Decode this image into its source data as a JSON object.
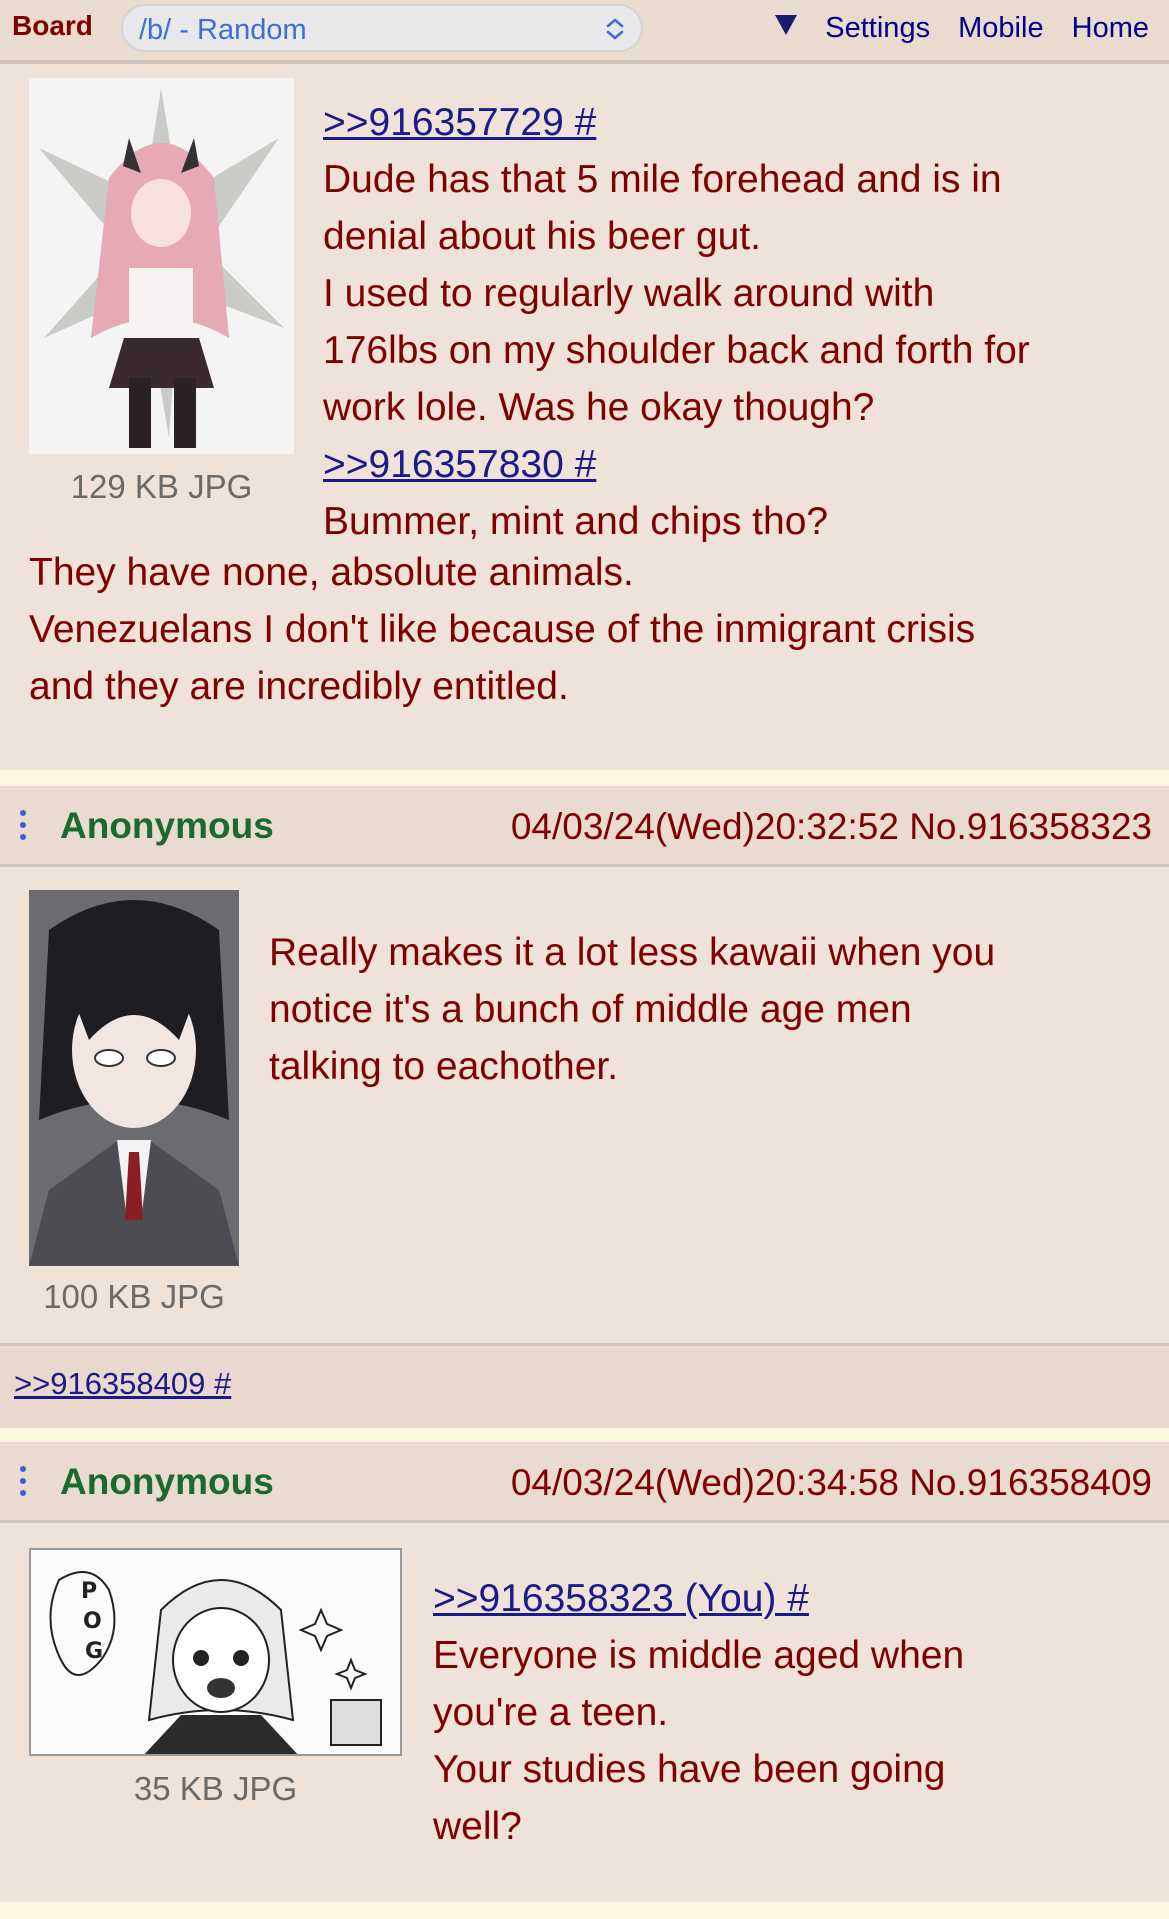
{
  "topbar": {
    "board_label": "Board",
    "board_select_value": "/b/ - Random",
    "nav": [
      "Settings",
      "Mobile",
      "Home"
    ]
  },
  "colors": {
    "page_bg": "#f8f4dc",
    "post_bg": "#efe2d8",
    "text": "#800000",
    "name": "#1c6b2e",
    "link": "#1a1a8c"
  },
  "posts": [
    {
      "thumb_icon": "anime-pink-hair-thumbnail",
      "file_info": "129 KB JPG",
      "lines": [
        {
          "type": "link",
          "text": ">>916357729 #"
        },
        {
          "type": "text",
          "text": "Dude has that 5 mile forehead and is in"
        },
        {
          "type": "text",
          "text": "denial about his beer gut."
        },
        {
          "type": "text",
          "text": "I used to regularly walk around with"
        },
        {
          "type": "text",
          "text": "176lbs on my shoulder back and forth for"
        },
        {
          "type": "text",
          "text": "work lole. Was he okay though?"
        },
        {
          "type": "link",
          "text": ">>916357830 #"
        },
        {
          "type": "text",
          "text": "Bummer, mint and chips tho?"
        },
        {
          "type": "text",
          "text": "They have none, absolute animals."
        },
        {
          "type": "text",
          "text": "Venezuelans I don't like because of the inmigrant crisis"
        },
        {
          "type": "text",
          "text": "and they are incredibly entitled."
        }
      ]
    },
    {
      "name": "Anonymous",
      "meta": "04/03/24(Wed)20:32:52 No.916358323",
      "thumb_icon": "anime-dark-hair-thumbnail",
      "file_info": "100 KB JPG",
      "lines": [
        {
          "type": "text",
          "text": "Really makes it a lot less kawaii when you"
        },
        {
          "type": "text",
          "text": "notice it's a bunch of middle age men"
        },
        {
          "type": "text",
          "text": "talking to eachother."
        }
      ],
      "backlink": ">>916358409 #"
    },
    {
      "name": "Anonymous",
      "meta": "04/03/24(Wed)20:34:58 No.916358409",
      "thumb_icon": "manga-pog-thumbnail",
      "thumb_text": "POG",
      "file_info": "35 KB JPG",
      "lines": [
        {
          "type": "link",
          "text": ">>916358323 (You) #"
        },
        {
          "type": "text",
          "text": "Everyone is middle aged when"
        },
        {
          "type": "text",
          "text": "you're a teen."
        },
        {
          "type": "text",
          "text": "Your studies have been going"
        },
        {
          "type": "text",
          "text": "well?"
        }
      ]
    }
  ]
}
